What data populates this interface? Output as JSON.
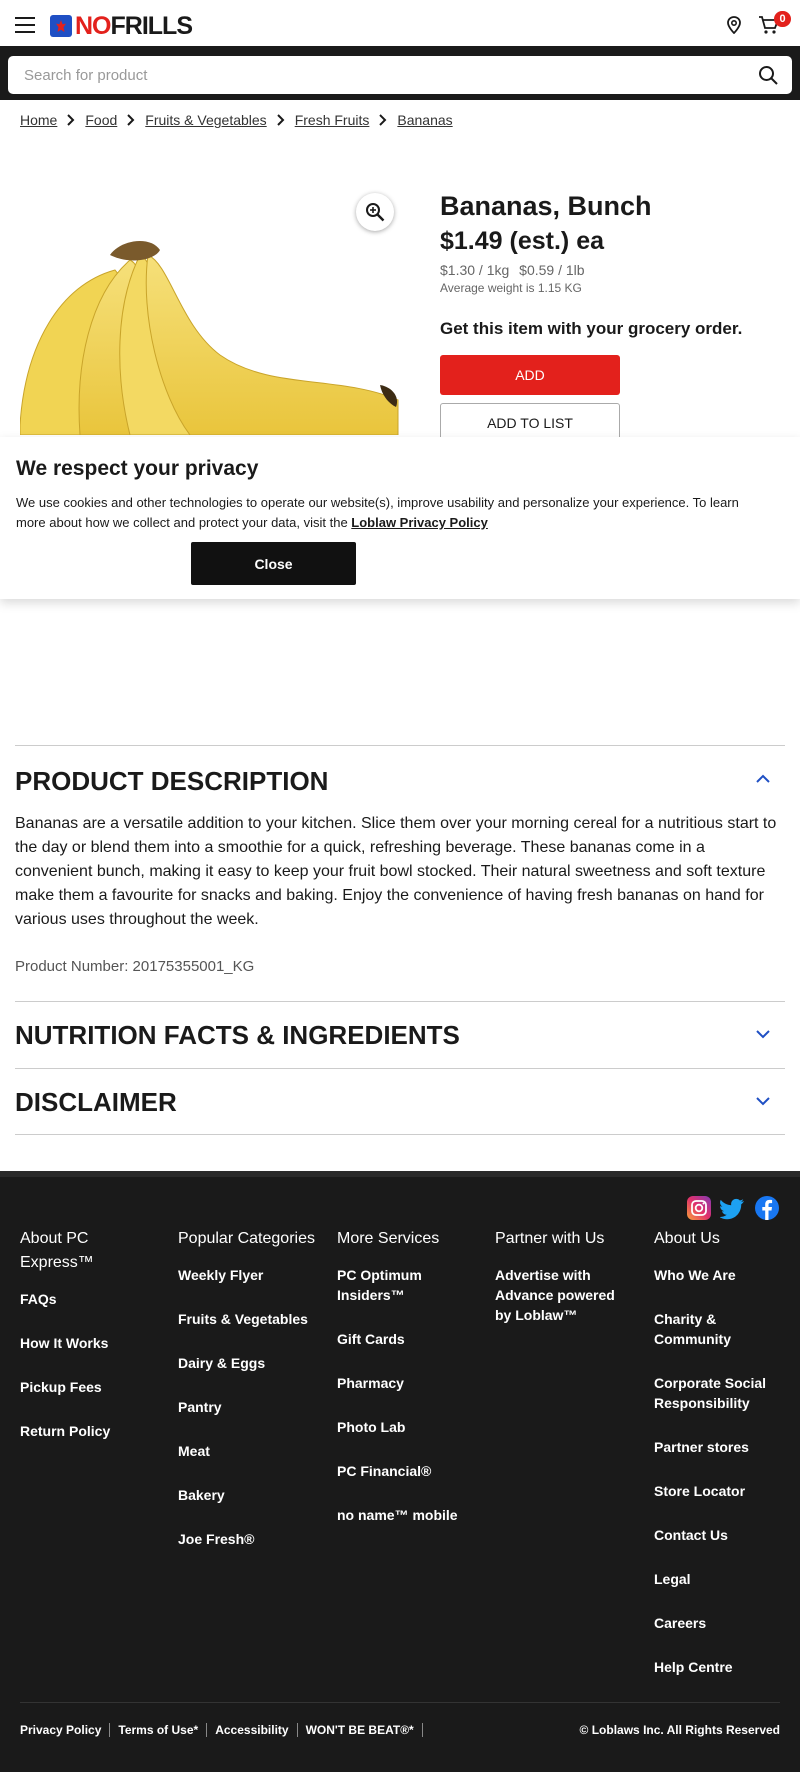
{
  "header": {
    "logo_no": "NO",
    "logo_frills": "FRILLS",
    "cart_count": "0"
  },
  "search": {
    "placeholder": "Search for product"
  },
  "breadcrumb": [
    "Home",
    "Food",
    "Fruits & Vegetables",
    "Fresh Fruits",
    "Bananas"
  ],
  "product": {
    "title": "Bananas, Bunch",
    "price": "$1.49",
    "price_est": "(est.)",
    "price_unit": "ea",
    "unit_price_kg": "$1.30 / 1kg",
    "unit_price_lb": "$0.59 / 1lb",
    "avg_weight": "Average weight is 1.15 KG",
    "order_text": "Get this item with your grocery order.",
    "add_label": "ADD",
    "add_list_label": "ADD TO LIST"
  },
  "privacy": {
    "title": "We respect your privacy",
    "text": "We use cookies and other technologies to operate our website(s), improve usability and personalize your experience. To learn more about how we collect and protect your data, visit the ",
    "link": "Loblaw Privacy Policy",
    "close": "Close"
  },
  "description": {
    "title": "PRODUCT DESCRIPTION",
    "text": "Bananas are a versatile addition to your kitchen. Slice them over your morning cereal for a nutritious start to the day or blend them into a smoothie for a quick, refreshing beverage. These bananas come in a convenient bunch, making it easy to keep your fruit bowl stocked. Their natural sweetness and soft texture make them a favourite for snacks and baking. Enjoy the convenience of having fresh bananas on hand for various uses throughout the week.",
    "product_number": "Product Number: 20175355001_KG"
  },
  "nutrition": {
    "title": "NUTRITION FACTS & INGREDIENTS"
  },
  "disclaimer": {
    "title": "DISCLAIMER"
  },
  "footer": {
    "columns": [
      {
        "heading": "About PC Express™",
        "links": [
          "FAQs",
          "How It Works",
          "Pickup Fees",
          "Return Policy"
        ]
      },
      {
        "heading": "Popular Categories",
        "links": [
          "Weekly Flyer",
          "Fruits & Vegetables",
          "Dairy & Eggs",
          "Pantry",
          "Meat",
          "Bakery",
          "Joe Fresh®"
        ]
      },
      {
        "heading": "More Services",
        "links": [
          "PC Optimum Insiders™",
          "Gift Cards",
          "Pharmacy",
          "Photo Lab",
          "PC Financial®",
          "no name™ mobile"
        ]
      },
      {
        "heading": "Partner with Us",
        "links": [
          "Advertise with Advance powered by Loblaw™"
        ]
      },
      {
        "heading": "About Us",
        "links": [
          "Who We Are",
          "Charity & Community",
          "Corporate Social Responsibility",
          "Partner stores",
          "Store Locator",
          "Contact Us",
          "Legal",
          "Careers",
          "Help Centre"
        ]
      }
    ],
    "bottom_links": [
      "Privacy Policy",
      "Terms of Use*",
      "Accessibility",
      "WON'T BE BEAT®*"
    ],
    "copyright": "© Loblaws Inc. All Rights Reserved"
  },
  "colors": {
    "brand_red": "#e3211c",
    "brand_blue": "#1f4fc4",
    "dark": "#1a1a1a"
  }
}
